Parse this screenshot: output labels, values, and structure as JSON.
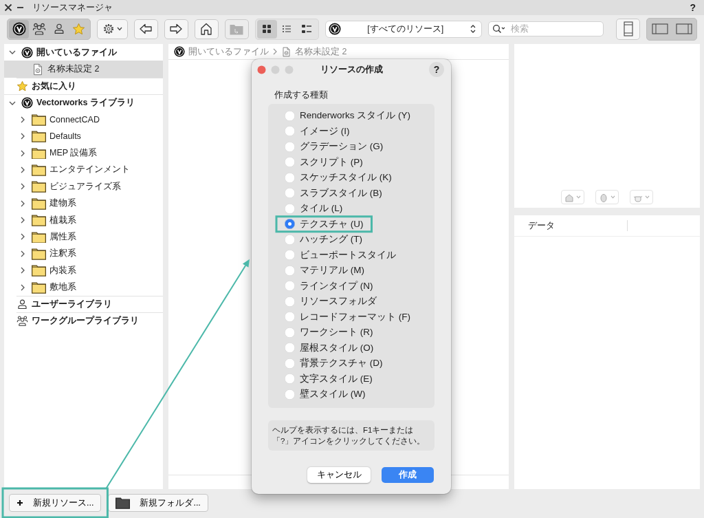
{
  "window": {
    "title": "リソースマネージャ",
    "help": "?"
  },
  "toolbar": {
    "library_filters": [
      {
        "kind": "vectorworks",
        "selected": true
      },
      {
        "kind": "workgroup",
        "selected": false
      },
      {
        "kind": "user",
        "selected": false
      },
      {
        "kind": "favorites",
        "selected": false
      }
    ],
    "up_button": {
      "disabled": true
    },
    "views": [
      {
        "kind": "grid",
        "selected": true
      },
      {
        "kind": "list",
        "selected": false
      },
      {
        "kind": "details",
        "selected": false
      }
    ],
    "library_select": {
      "value": "[すべてのリソース]"
    },
    "search": {
      "placeholder": "検索"
    }
  },
  "tree": [
    {
      "label": "開いているファイル",
      "kind": "library",
      "selected": false,
      "expanded": true,
      "children": [
        {
          "label": "名称未設定 2",
          "kind": "document",
          "selected": true
        }
      ]
    },
    {
      "label": "お気に入り",
      "kind": "favorites",
      "selected": false
    },
    {
      "label": "Vectorworks ライブラリ",
      "kind": "library",
      "selected": false,
      "expanded": true,
      "children": [
        {
          "label": "ConnectCAD",
          "kind": "folder",
          "selected": false,
          "expanded": false
        },
        {
          "label": "Defaults",
          "kind": "folder",
          "selected": false,
          "expanded": false
        },
        {
          "label": "MEP 設備系",
          "kind": "folder",
          "selected": false,
          "expanded": false
        },
        {
          "label": "エンタテインメント",
          "kind": "folder",
          "selected": false,
          "expanded": false
        },
        {
          "label": "ビジュアライズ系",
          "kind": "folder",
          "selected": false,
          "expanded": false
        },
        {
          "label": "建物系",
          "kind": "folder",
          "selected": false,
          "expanded": false
        },
        {
          "label": "植栽系",
          "kind": "folder",
          "selected": false,
          "expanded": false
        },
        {
          "label": "属性系",
          "kind": "folder",
          "selected": false,
          "expanded": false
        },
        {
          "label": "注釈系",
          "kind": "folder",
          "selected": false,
          "expanded": false
        },
        {
          "label": "内装系",
          "kind": "folder",
          "selected": false,
          "expanded": false
        },
        {
          "label": "敷地系",
          "kind": "folder",
          "selected": false,
          "expanded": false
        }
      ]
    },
    {
      "label": "ユーザーライブラリ",
      "kind": "user",
      "selected": false
    },
    {
      "label": "ワークグループライブラリ",
      "kind": "workgroup",
      "selected": false
    }
  ],
  "breadcrumb": [
    "開いているファイル",
    "名称未設定 2"
  ],
  "info_pane": {
    "data_header": "データ"
  },
  "dialog": {
    "title": "リソースの作成",
    "help": "?",
    "group_label": "作成する種類",
    "options": [
      {
        "label": "Renderworks スタイル (Y)",
        "selected": false,
        "highlighted": false
      },
      {
        "label": "イメージ (I)",
        "selected": false,
        "highlighted": false
      },
      {
        "label": "グラデーション (G)",
        "selected": false,
        "highlighted": false
      },
      {
        "label": "スクリプト (P)",
        "selected": false,
        "highlighted": false
      },
      {
        "label": "スケッチスタイル (K)",
        "selected": false,
        "highlighted": false
      },
      {
        "label": "スラブスタイル (B)",
        "selected": false,
        "highlighted": false
      },
      {
        "label": "タイル (L)",
        "selected": false,
        "highlighted": false
      },
      {
        "label": "テクスチャ (U)",
        "selected": true,
        "highlighted": true
      },
      {
        "label": "ハッチング (T)",
        "selected": false,
        "highlighted": false
      },
      {
        "label": "ビューポートスタイル",
        "selected": false,
        "highlighted": false
      },
      {
        "label": "マテリアル (M)",
        "selected": false,
        "highlighted": false
      },
      {
        "label": "ラインタイプ (N)",
        "selected": false,
        "highlighted": false
      },
      {
        "label": "リソースフォルダ",
        "selected": false,
        "highlighted": false
      },
      {
        "label": "レコードフォーマット (F)",
        "selected": false,
        "highlighted": false
      },
      {
        "label": "ワークシート (R)",
        "selected": false,
        "highlighted": false
      },
      {
        "label": "屋根スタイル (O)",
        "selected": false,
        "highlighted": false
      },
      {
        "label": "背景テクスチャ (D)",
        "selected": false,
        "highlighted": false
      },
      {
        "label": "文字スタイル (E)",
        "selected": false,
        "highlighted": false
      },
      {
        "label": "壁スタイル (W)",
        "selected": false,
        "highlighted": false
      }
    ],
    "help_text": "ヘルプを表示するには、F1キーまたは「?」アイコンをクリックしてください。",
    "buttons": [
      {
        "label": "キャンセル",
        "kind": "secondary"
      },
      {
        "label": "作成",
        "kind": "primary"
      }
    ]
  },
  "bottom_bar": {
    "buttons": [
      {
        "label": "新規リソース...",
        "kind": "new_resource",
        "highlighted": true
      },
      {
        "label": "新規フォルダ...",
        "kind": "new_folder",
        "highlighted": false
      }
    ]
  }
}
